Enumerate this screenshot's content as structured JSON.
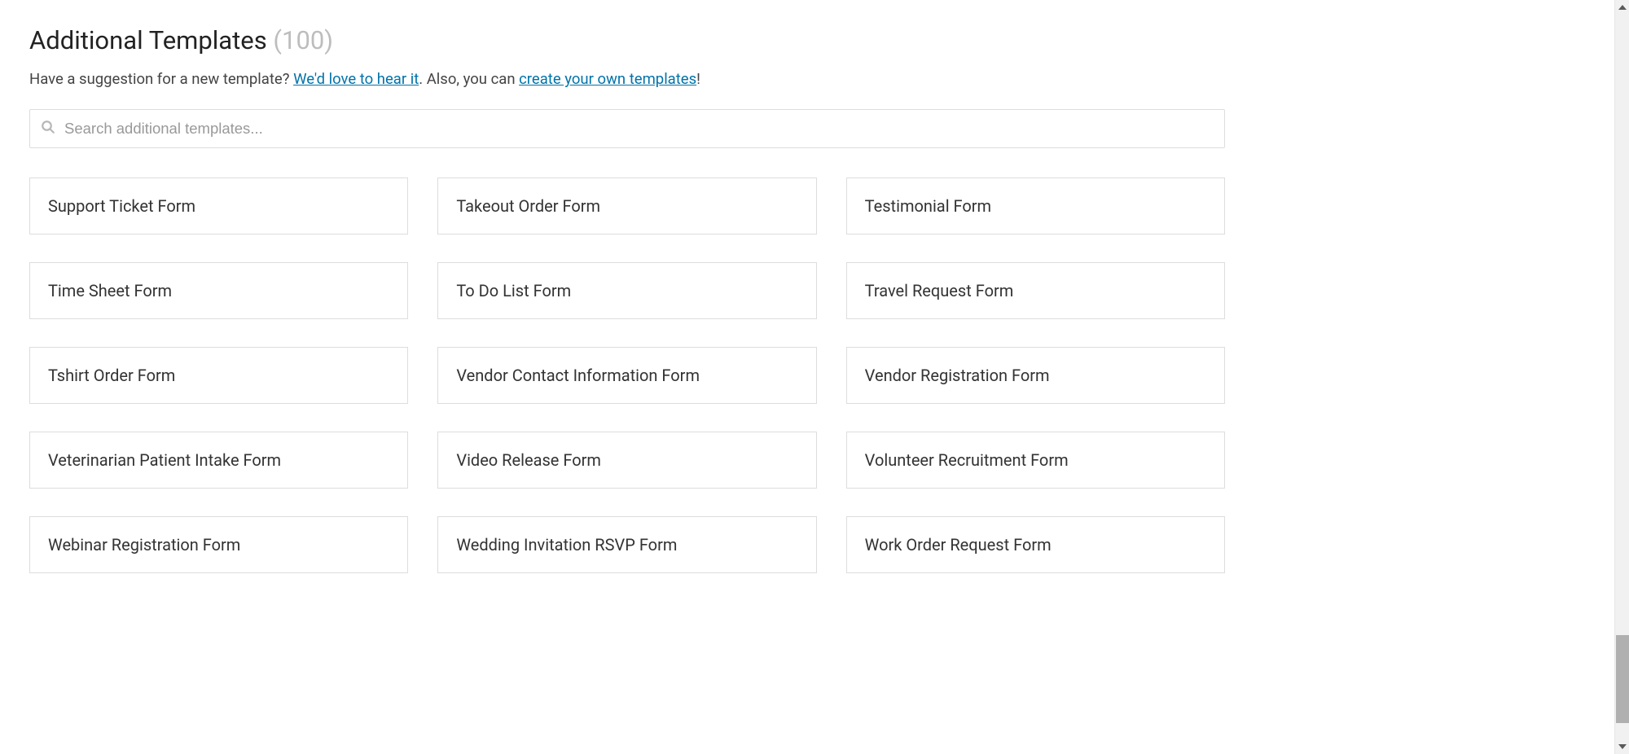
{
  "header": {
    "title": "Additional Templates",
    "count": "(100)"
  },
  "subtext": {
    "prefix": "Have a suggestion for a new template? ",
    "link1": "We'd love to hear it",
    "mid": ". Also, you can ",
    "link2": "create your own templates",
    "suffix": "!"
  },
  "search": {
    "placeholder": "Search additional templates...",
    "value": ""
  },
  "templates": [
    {
      "label": "Support Ticket Form"
    },
    {
      "label": "Takeout Order Form"
    },
    {
      "label": "Testimonial Form"
    },
    {
      "label": "Time Sheet Form"
    },
    {
      "label": "To Do List Form"
    },
    {
      "label": "Travel Request Form"
    },
    {
      "label": "Tshirt Order Form"
    },
    {
      "label": "Vendor Contact Information Form"
    },
    {
      "label": "Vendor Registration Form"
    },
    {
      "label": "Veterinarian Patient Intake Form"
    },
    {
      "label": "Video Release Form"
    },
    {
      "label": "Volunteer Recruitment Form"
    },
    {
      "label": "Webinar Registration Form"
    },
    {
      "label": "Wedding Invitation RSVP Form"
    },
    {
      "label": "Work Order Request Form"
    }
  ]
}
